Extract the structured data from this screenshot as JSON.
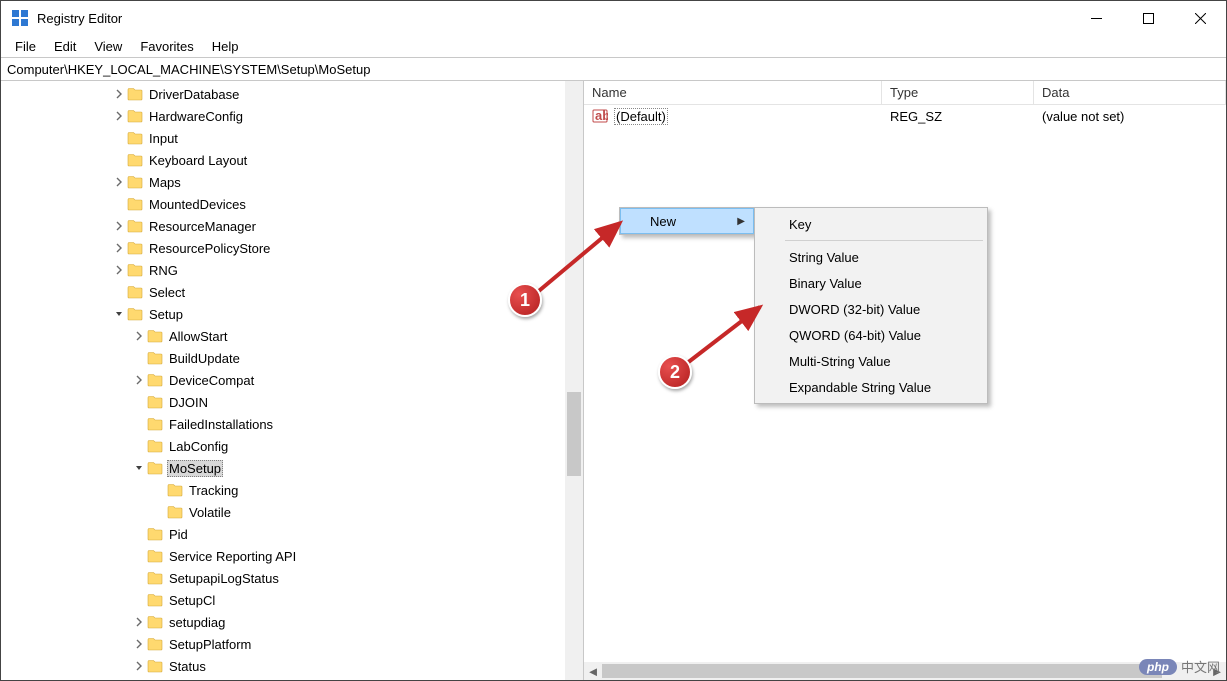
{
  "app": {
    "title": "Registry Editor"
  },
  "menubar": [
    "File",
    "Edit",
    "View",
    "Favorites",
    "Help"
  ],
  "address": "Computer\\HKEY_LOCAL_MACHINE\\SYSTEM\\Setup\\MoSetup",
  "tree": [
    {
      "indent": 3,
      "exp": "closed",
      "label": "DriverDatabase"
    },
    {
      "indent": 3,
      "exp": "closed",
      "label": "HardwareConfig"
    },
    {
      "indent": 3,
      "exp": "none",
      "label": "Input"
    },
    {
      "indent": 3,
      "exp": "none",
      "label": "Keyboard Layout"
    },
    {
      "indent": 3,
      "exp": "closed",
      "label": "Maps"
    },
    {
      "indent": 3,
      "exp": "none",
      "label": "MountedDevices"
    },
    {
      "indent": 3,
      "exp": "closed",
      "label": "ResourceManager"
    },
    {
      "indent": 3,
      "exp": "closed",
      "label": "ResourcePolicyStore"
    },
    {
      "indent": 3,
      "exp": "closed",
      "label": "RNG"
    },
    {
      "indent": 3,
      "exp": "none",
      "label": "Select"
    },
    {
      "indent": 3,
      "exp": "open",
      "label": "Setup"
    },
    {
      "indent": 4,
      "exp": "closed",
      "label": "AllowStart"
    },
    {
      "indent": 4,
      "exp": "none",
      "label": "BuildUpdate"
    },
    {
      "indent": 4,
      "exp": "closed",
      "label": "DeviceCompat"
    },
    {
      "indent": 4,
      "exp": "none",
      "label": "DJOIN"
    },
    {
      "indent": 4,
      "exp": "none",
      "label": "FailedInstallations"
    },
    {
      "indent": 4,
      "exp": "none",
      "label": "LabConfig"
    },
    {
      "indent": 4,
      "exp": "open",
      "label": "MoSetup",
      "selected": true
    },
    {
      "indent": 5,
      "exp": "none",
      "label": "Tracking"
    },
    {
      "indent": 5,
      "exp": "none",
      "label": "Volatile"
    },
    {
      "indent": 4,
      "exp": "none",
      "label": "Pid"
    },
    {
      "indent": 4,
      "exp": "none",
      "label": "Service Reporting API"
    },
    {
      "indent": 4,
      "exp": "none",
      "label": "SetupapiLogStatus"
    },
    {
      "indent": 4,
      "exp": "none",
      "label": "SetupCl"
    },
    {
      "indent": 4,
      "exp": "closed",
      "label": "setupdiag"
    },
    {
      "indent": 4,
      "exp": "closed",
      "label": "SetupPlatform"
    },
    {
      "indent": 4,
      "exp": "closed",
      "label": "Status"
    }
  ],
  "list": {
    "headers": {
      "name": "Name",
      "type": "Type",
      "data": "Data"
    },
    "rows": [
      {
        "name": "(Default)",
        "type": "REG_SZ",
        "data": "(value not set)"
      }
    ]
  },
  "ctx_primary": {
    "new": "New"
  },
  "ctx_sub": [
    "Key",
    null,
    "String Value",
    "Binary Value",
    "DWORD (32-bit) Value",
    "QWORD (64-bit) Value",
    "Multi-String Value",
    "Expandable String Value"
  ],
  "annotations": {
    "badge1": "1",
    "badge2": "2"
  },
  "watermark": {
    "pill": "php",
    "text": "中文网"
  }
}
